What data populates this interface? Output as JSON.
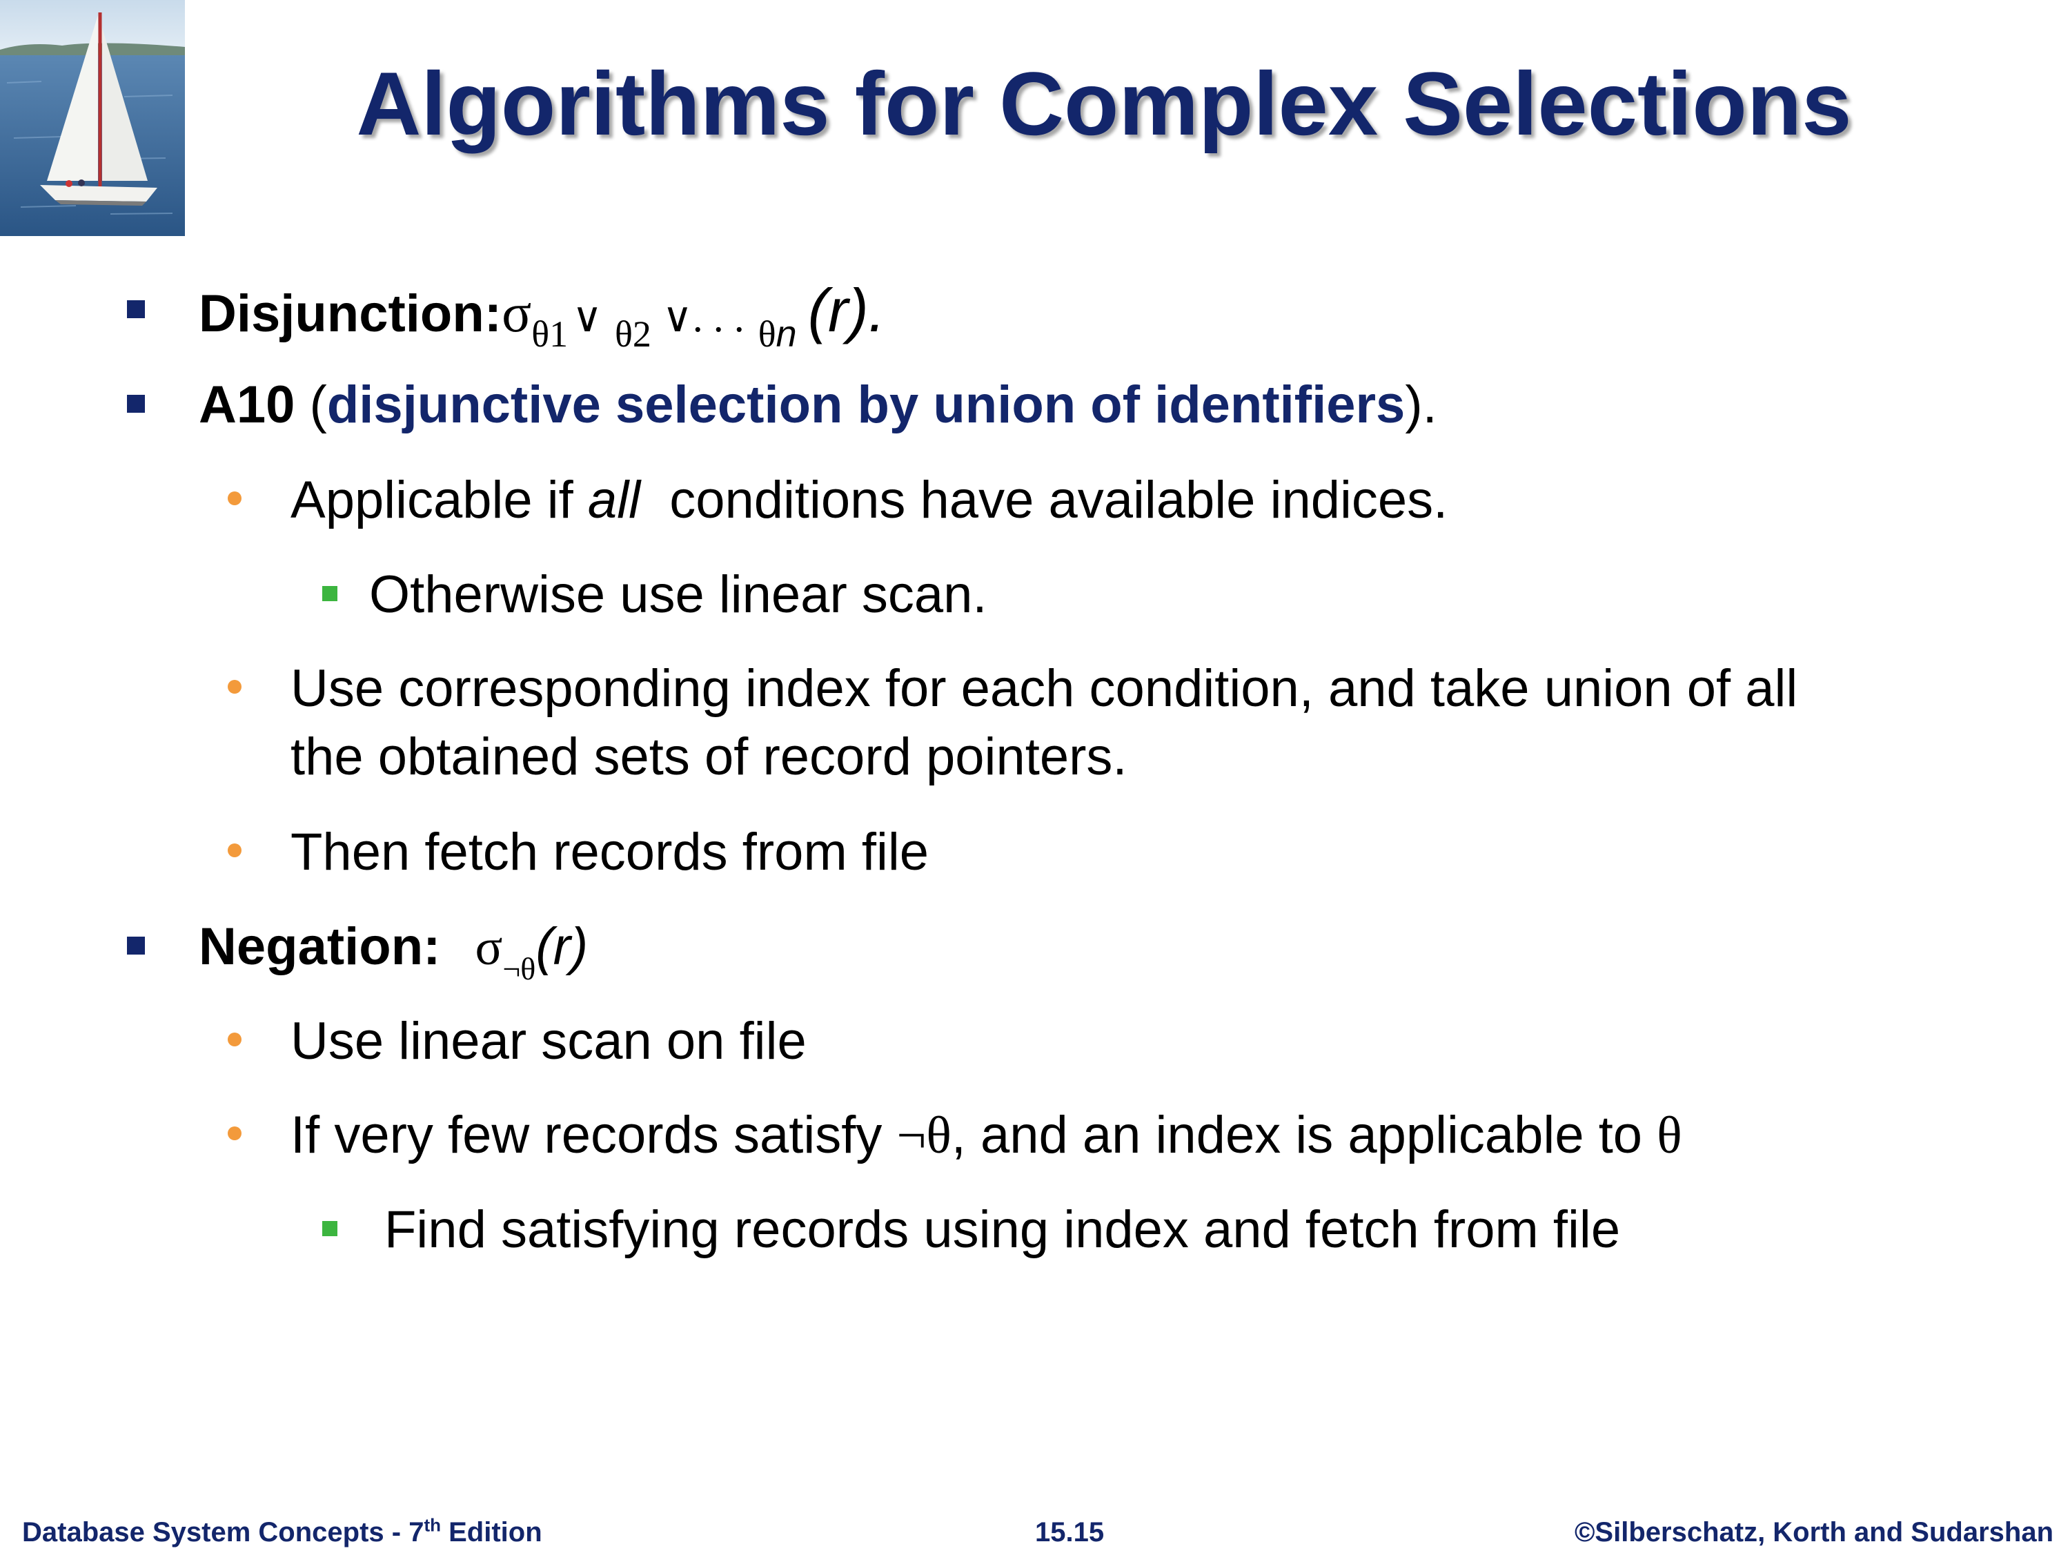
{
  "slide": {
    "title": "Algorithms for Complex Selections",
    "bullets": {
      "disjunction": {
        "label": "Disjunction:",
        "sigma": "σ",
        "sub1": "θ1",
        "or1": "∨",
        "sub2": "θ2",
        "or2": "∨. . .",
        "subn": "θ",
        "subn_n": "n",
        "rel": "(r)."
      },
      "a10": {
        "label": "A10",
        "open": " (",
        "highlight": "disjunctive selection by union of identifiers",
        "close": ")."
      },
      "applicable": {
        "pre": "Applicable if ",
        "em": "all",
        "post": "  conditions have available indices."
      },
      "otherwise": "Otherwise use linear scan.",
      "use_index_line1": "Use corresponding index for each condition, and take union of all",
      "use_index_line2": "the obtained sets of record pointers.",
      "then_fetch": "Then fetch records from file",
      "negation": {
        "label": "Negation:",
        "sigma": "σ",
        "sub": "¬θ",
        "rel": "(r)"
      },
      "linear_scan": "Use linear scan on file",
      "few_records": {
        "pre": "If very few records satisfy ",
        "sym1": "¬θ",
        "mid": ", and an index is applicable to ",
        "sym2": "θ"
      },
      "find_satisfying": "Find satisfying records using index and fetch from file"
    }
  },
  "footer": {
    "left_pre": "Database System Concepts - 7",
    "left_sup": "th",
    "left_post": " Edition",
    "center": "15.15",
    "right": "©Silberschatz, Korth and Sudarshan"
  },
  "colors": {
    "title": "#13266b",
    "level1_bullet": "#13266b",
    "level2_bullet": "#f39a3b",
    "level3_bullet": "#3cb53f"
  }
}
